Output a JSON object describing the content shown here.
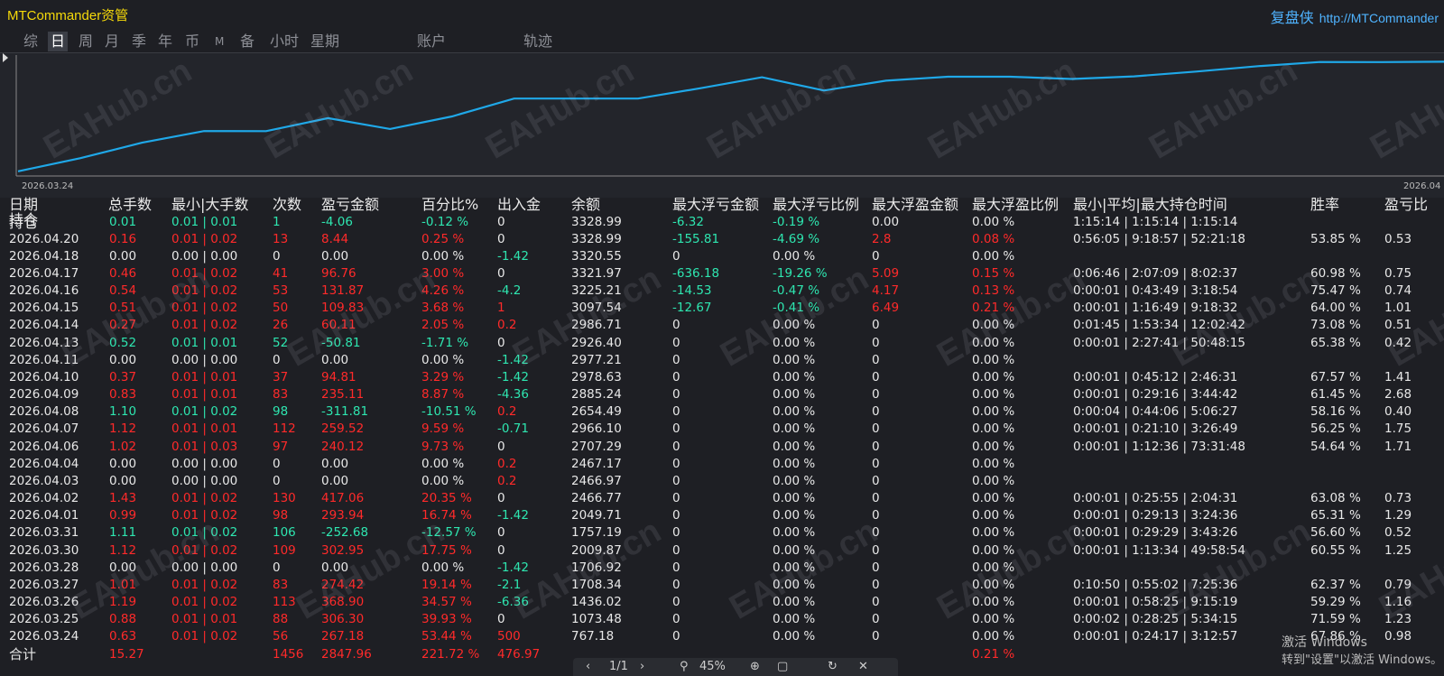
{
  "app": {
    "title": "MTCommander资管",
    "brand": "复盘侠",
    "url": "http://MTCommander"
  },
  "tabs": [
    {
      "label": "综",
      "active": false
    },
    {
      "label": "日",
      "active": true
    },
    {
      "label": "周",
      "active": false
    },
    {
      "label": "月",
      "active": false
    },
    {
      "label": "季",
      "active": false
    },
    {
      "label": "年",
      "active": false
    },
    {
      "label": "币",
      "active": false
    },
    {
      "label": "M",
      "active": false
    },
    {
      "label": "备",
      "active": false
    },
    {
      "label": "小时",
      "active": false
    },
    {
      "label": "星期",
      "active": false
    },
    {
      "label": "账户",
      "active": false
    },
    {
      "label": "轨迹",
      "active": false
    }
  ],
  "chart": {
    "x_start_label": "2026.03.24",
    "x_end_label": "2026.04",
    "line_color": "#1fa8e8",
    "series_balance": [
      767.18,
      1073.48,
      1436.02,
      1708.34,
      1706.92,
      2009.87,
      1757.19,
      2049.71,
      2466.77,
      2466.97,
      2467.17,
      2707.29,
      2966.1,
      2654.49,
      2885.24,
      2978.63,
      2977.21,
      2926.4,
      2986.71,
      3097.54,
      3225.21,
      3321.97,
      3320.55,
      3328.99
    ]
  },
  "watermark": "EAHub.cn",
  "headers": {
    "date": "日期",
    "date2": "持仓",
    "lots": "总手数",
    "minmax": "最小|大手数",
    "count": "次数",
    "pnl": "盈亏金额",
    "pct": "百分比%",
    "flow": "出入金",
    "balance": "余额",
    "maxfl": "最大浮亏金额",
    "maxflpct": "最大浮亏比例",
    "maxfp": "最大浮盈金额",
    "maxfppct": "最大浮盈比例",
    "holdtime": "最小|平均|最大持仓时间",
    "win": "胜率",
    "ratio": "盈亏比"
  },
  "rows": [
    [
      "持仓",
      "0.01",
      "0.01 | 0.01",
      "1",
      "-4.06",
      "-0.12 %",
      "0",
      "3328.99",
      "-6.32",
      "-0.19 %",
      "0.00",
      "0.00 %",
      "1:15:14 | 1:15:14 | 1:15:14",
      "",
      ""
    ],
    [
      "2026.04.20",
      "0.16",
      "0.01 | 0.02",
      "13",
      "8.44",
      "0.25 %",
      "0",
      "3328.99",
      "-155.81",
      "-4.69 %",
      "2.8",
      "0.08 %",
      "0:56:05 | 9:18:57 | 52:21:18",
      "53.85 %",
      "0.53"
    ],
    [
      "2026.04.18",
      "0.00",
      "0.00 | 0.00",
      "0",
      "0.00",
      "0.00 %",
      "-1.42",
      "3320.55",
      "0",
      "0.00 %",
      "0",
      "0.00 %",
      "",
      "",
      ""
    ],
    [
      "2026.04.17",
      "0.46",
      "0.01 | 0.02",
      "41",
      "96.76",
      "3.00 %",
      "0",
      "3321.97",
      "-636.18",
      "-19.26 %",
      "5.09",
      "0.15 %",
      "0:06:46 | 2:07:09 | 8:02:37",
      "60.98 %",
      "0.75"
    ],
    [
      "2026.04.16",
      "0.54",
      "0.01 | 0.02",
      "53",
      "131.87",
      "4.26 %",
      "-4.2",
      "3225.21",
      "-14.53",
      "-0.47 %",
      "4.17",
      "0.13 %",
      "0:00:01 | 0:43:49 | 3:18:54",
      "75.47 %",
      "0.74"
    ],
    [
      "2026.04.15",
      "0.51",
      "0.01 | 0.02",
      "50",
      "109.83",
      "3.68 %",
      "1",
      "3097.54",
      "-12.67",
      "-0.41 %",
      "6.49",
      "0.21 %",
      "0:00:01 | 1:16:49 | 9:18:32",
      "64.00 %",
      "1.01"
    ],
    [
      "2026.04.14",
      "0.27",
      "0.01 | 0.02",
      "26",
      "60.11",
      "2.05 %",
      "0.2",
      "2986.71",
      "0",
      "0.00 %",
      "0",
      "0.00 %",
      "0:01:45 | 1:53:34 | 12:02:42",
      "73.08 %",
      "0.51"
    ],
    [
      "2026.04.13",
      "0.52",
      "0.01 | 0.01",
      "52",
      "-50.81",
      "-1.71 %",
      "0",
      "2926.40",
      "0",
      "0.00 %",
      "0",
      "0.00 %",
      "0:00:01 | 2:27:41 | 50:48:15",
      "65.38 %",
      "0.42"
    ],
    [
      "2026.04.11",
      "0.00",
      "0.00 | 0.00",
      "0",
      "0.00",
      "0.00 %",
      "-1.42",
      "2977.21",
      "0",
      "0.00 %",
      "0",
      "0.00 %",
      "",
      "",
      ""
    ],
    [
      "2026.04.10",
      "0.37",
      "0.01 | 0.01",
      "37",
      "94.81",
      "3.29 %",
      "-1.42",
      "2978.63",
      "0",
      "0.00 %",
      "0",
      "0.00 %",
      "0:00:01 | 0:45:12 | 2:46:31",
      "67.57 %",
      "1.41"
    ],
    [
      "2026.04.09",
      "0.83",
      "0.01 | 0.01",
      "83",
      "235.11",
      "8.87 %",
      "-4.36",
      "2885.24",
      "0",
      "0.00 %",
      "0",
      "0.00 %",
      "0:00:01 | 0:29:16 | 3:44:42",
      "61.45 %",
      "2.68"
    ],
    [
      "2026.04.08",
      "1.10",
      "0.01 | 0.02",
      "98",
      "-311.81",
      "-10.51 %",
      "0.2",
      "2654.49",
      "0",
      "0.00 %",
      "0",
      "0.00 %",
      "0:00:04 | 0:44:06 | 5:06:27",
      "58.16 %",
      "0.40"
    ],
    [
      "2026.04.07",
      "1.12",
      "0.01 | 0.01",
      "112",
      "259.52",
      "9.59 %",
      "-0.71",
      "2966.10",
      "0",
      "0.00 %",
      "0",
      "0.00 %",
      "0:00:01 | 0:21:10 | 3:26:49",
      "56.25 %",
      "1.75"
    ],
    [
      "2026.04.06",
      "1.02",
      "0.01 | 0.03",
      "97",
      "240.12",
      "9.73 %",
      "0",
      "2707.29",
      "0",
      "0.00 %",
      "0",
      "0.00 %",
      "0:00:01 | 1:12:36 | 73:31:48",
      "54.64 %",
      "1.71"
    ],
    [
      "2026.04.04",
      "0.00",
      "0.00 | 0.00",
      "0",
      "0.00",
      "0.00 %",
      "0.2",
      "2467.17",
      "0",
      "0.00 %",
      "0",
      "0.00 %",
      "",
      "",
      ""
    ],
    [
      "2026.04.03",
      "0.00",
      "0.00 | 0.00",
      "0",
      "0.00",
      "0.00 %",
      "0.2",
      "2466.97",
      "0",
      "0.00 %",
      "0",
      "0.00 %",
      "",
      "",
      ""
    ],
    [
      "2026.04.02",
      "1.43",
      "0.01 | 0.02",
      "130",
      "417.06",
      "20.35 %",
      "0",
      "2466.77",
      "0",
      "0.00 %",
      "0",
      "0.00 %",
      "0:00:01 | 0:25:55 | 2:04:31",
      "63.08 %",
      "0.73"
    ],
    [
      "2026.04.01",
      "0.99",
      "0.01 | 0.02",
      "98",
      "293.94",
      "16.74 %",
      "-1.42",
      "2049.71",
      "0",
      "0.00 %",
      "0",
      "0.00 %",
      "0:00:01 | 0:29:13 | 3:24:36",
      "65.31 %",
      "1.29"
    ],
    [
      "2026.03.31",
      "1.11",
      "0.01 | 0.02",
      "106",
      "-252.68",
      "-12.57 %",
      "0",
      "1757.19",
      "0",
      "0.00 %",
      "0",
      "0.00 %",
      "0:00:01 | 0:29:29 | 3:43:26",
      "56.60 %",
      "0.52"
    ],
    [
      "2026.03.30",
      "1.12",
      "0.01 | 0.02",
      "109",
      "302.95",
      "17.75 %",
      "0",
      "2009.87",
      "0",
      "0.00 %",
      "0",
      "0.00 %",
      "0:00:01 | 1:13:34 | 49:58:54",
      "60.55 %",
      "1.25"
    ],
    [
      "2026.03.28",
      "0.00",
      "0.00 | 0.00",
      "0",
      "0.00",
      "0.00 %",
      "-1.42",
      "1706.92",
      "0",
      "0.00 %",
      "0",
      "0.00 %",
      "",
      "",
      ""
    ],
    [
      "2026.03.27",
      "1.01",
      "0.01 | 0.02",
      "83",
      "274.42",
      "19.14 %",
      "-2.1",
      "1708.34",
      "0",
      "0.00 %",
      "0",
      "0.00 %",
      "0:10:50 | 0:55:02 | 7:25:36",
      "62.37 %",
      "0.79"
    ],
    [
      "2026.03.26",
      "1.19",
      "0.01 | 0.02",
      "113",
      "368.90",
      "34.57 %",
      "-6.36",
      "1436.02",
      "0",
      "0.00 %",
      "0",
      "0.00 %",
      "0:00:01 | 0:58:25 | 9:15:19",
      "59.29 %",
      "1.16"
    ],
    [
      "2026.03.25",
      "0.88",
      "0.01 | 0.01",
      "88",
      "306.30",
      "39.93 %",
      "0",
      "1073.48",
      "0",
      "0.00 %",
      "0",
      "0.00 %",
      "0:00:02 | 0:28:25 | 5:34:15",
      "71.59 %",
      "1.23"
    ],
    [
      "2026.03.24",
      "0.63",
      "0.01 | 0.02",
      "56",
      "267.18",
      "53.44 %",
      "500",
      "767.18",
      "0",
      "0.00 %",
      "0",
      "0.00 %",
      "0:00:01 | 0:24:17 | 3:12:57",
      "67.86 %",
      "0.98"
    ],
    [
      "合计",
      "15.27",
      "",
      "1456",
      "2847.96",
      "221.72 %",
      "476.97",
      "",
      "",
      "",
      "",
      "0.21 %",
      "",
      "",
      ""
    ]
  ],
  "activate_windows": {
    "line1": "激活 Windows",
    "line2": "转到\"设置\"以激活 Windows。"
  }
}
